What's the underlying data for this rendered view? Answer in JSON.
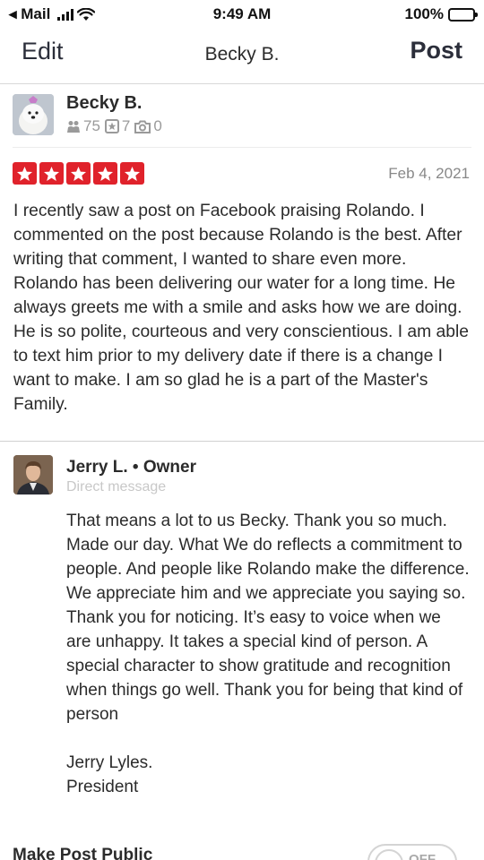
{
  "status_bar": {
    "carrier": "◂ Mail",
    "time": "9:49 AM",
    "battery": "100%"
  },
  "nav": {
    "edit_label": "Edit",
    "title": "Becky B.",
    "post_label": "Post"
  },
  "reviewer": {
    "name": "Becky B.",
    "friends": "75",
    "reviews": "7",
    "photos": "0"
  },
  "review": {
    "rating": 5,
    "date": "Feb 4, 2021",
    "text": "I recently saw a post on Facebook praising Rolando.  I commented on the post because Rolando is the best.  After writing that comment, I wanted to share even more.  Rolando has been delivering our water for a long time.  He always greets me with a smile and asks how we are doing.  He is so polite, courteous and very conscientious.  I am able to text him prior to my delivery date if there is a change I want to make. I am so glad he is a part of the Master's Family."
  },
  "owner_reply": {
    "name_role": "Jerry L. • Owner",
    "subtitle": "Direct message",
    "text": "That means a lot to us Becky.  Thank you so much.  Made our day.  What We do reflects a commitment to people.  And people like Rolando make the difference.  We appreciate him and we appreciate you saying so.  Thank you for noticing.  It’s easy to voice when we are unhappy.  It takes a special kind of person. A special character to show gratitude and recognition when things go well.  Thank you for being that kind of person\n\nJerry Lyles.\nPresident"
  },
  "bottom": {
    "label": "Make Post Public",
    "toggle_text": "OFF"
  },
  "colors": {
    "star_red": "#e0222b",
    "nav_text": "#2b2e3a",
    "muted": "#9a9a9a"
  }
}
